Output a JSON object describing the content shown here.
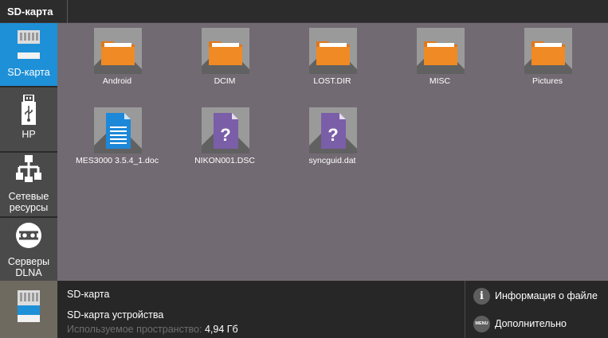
{
  "topbar": {
    "tab_label": "SD-карта"
  },
  "sidebar": {
    "items": [
      {
        "label": "SD-карта",
        "icon": "sd-card-icon",
        "active": true
      },
      {
        "label": "НР",
        "icon": "usb-icon",
        "active": false
      },
      {
        "label_line1": "Сетевые",
        "label_line2": "ресурсы",
        "icon": "network-icon",
        "active": false
      },
      {
        "label_line1": "Серверы",
        "label_line2": "DLNA",
        "icon": "dlna-icon",
        "active": false
      }
    ]
  },
  "files": [
    {
      "name": "Android",
      "type": "folder"
    },
    {
      "name": "DCIM",
      "type": "folder"
    },
    {
      "name": "LOST.DIR",
      "type": "folder"
    },
    {
      "name": "MISC",
      "type": "folder"
    },
    {
      "name": "Pictures",
      "type": "folder"
    },
    {
      "name": "MES3000 3.5.4_1.doc",
      "type": "document"
    },
    {
      "name": "NIKON001.DSC",
      "type": "unknown"
    },
    {
      "name": "syncguid.dat",
      "type": "unknown"
    }
  ],
  "bottom": {
    "title": "SD-карта",
    "subtitle": "SD-карта устройства",
    "space_label": "Используемое пространство:",
    "space_value": "4,94 Гб"
  },
  "actions": {
    "file_info_label": "Информация о файле",
    "file_info_glyph": "i",
    "more_label": "Дополнительно",
    "more_glyph": "MENU"
  },
  "colors": {
    "accent": "#1e90d8",
    "folder": "#f08a24",
    "document": "#1e88d8",
    "unknown": "#7b5ea8",
    "main_bg": "#726a72"
  }
}
